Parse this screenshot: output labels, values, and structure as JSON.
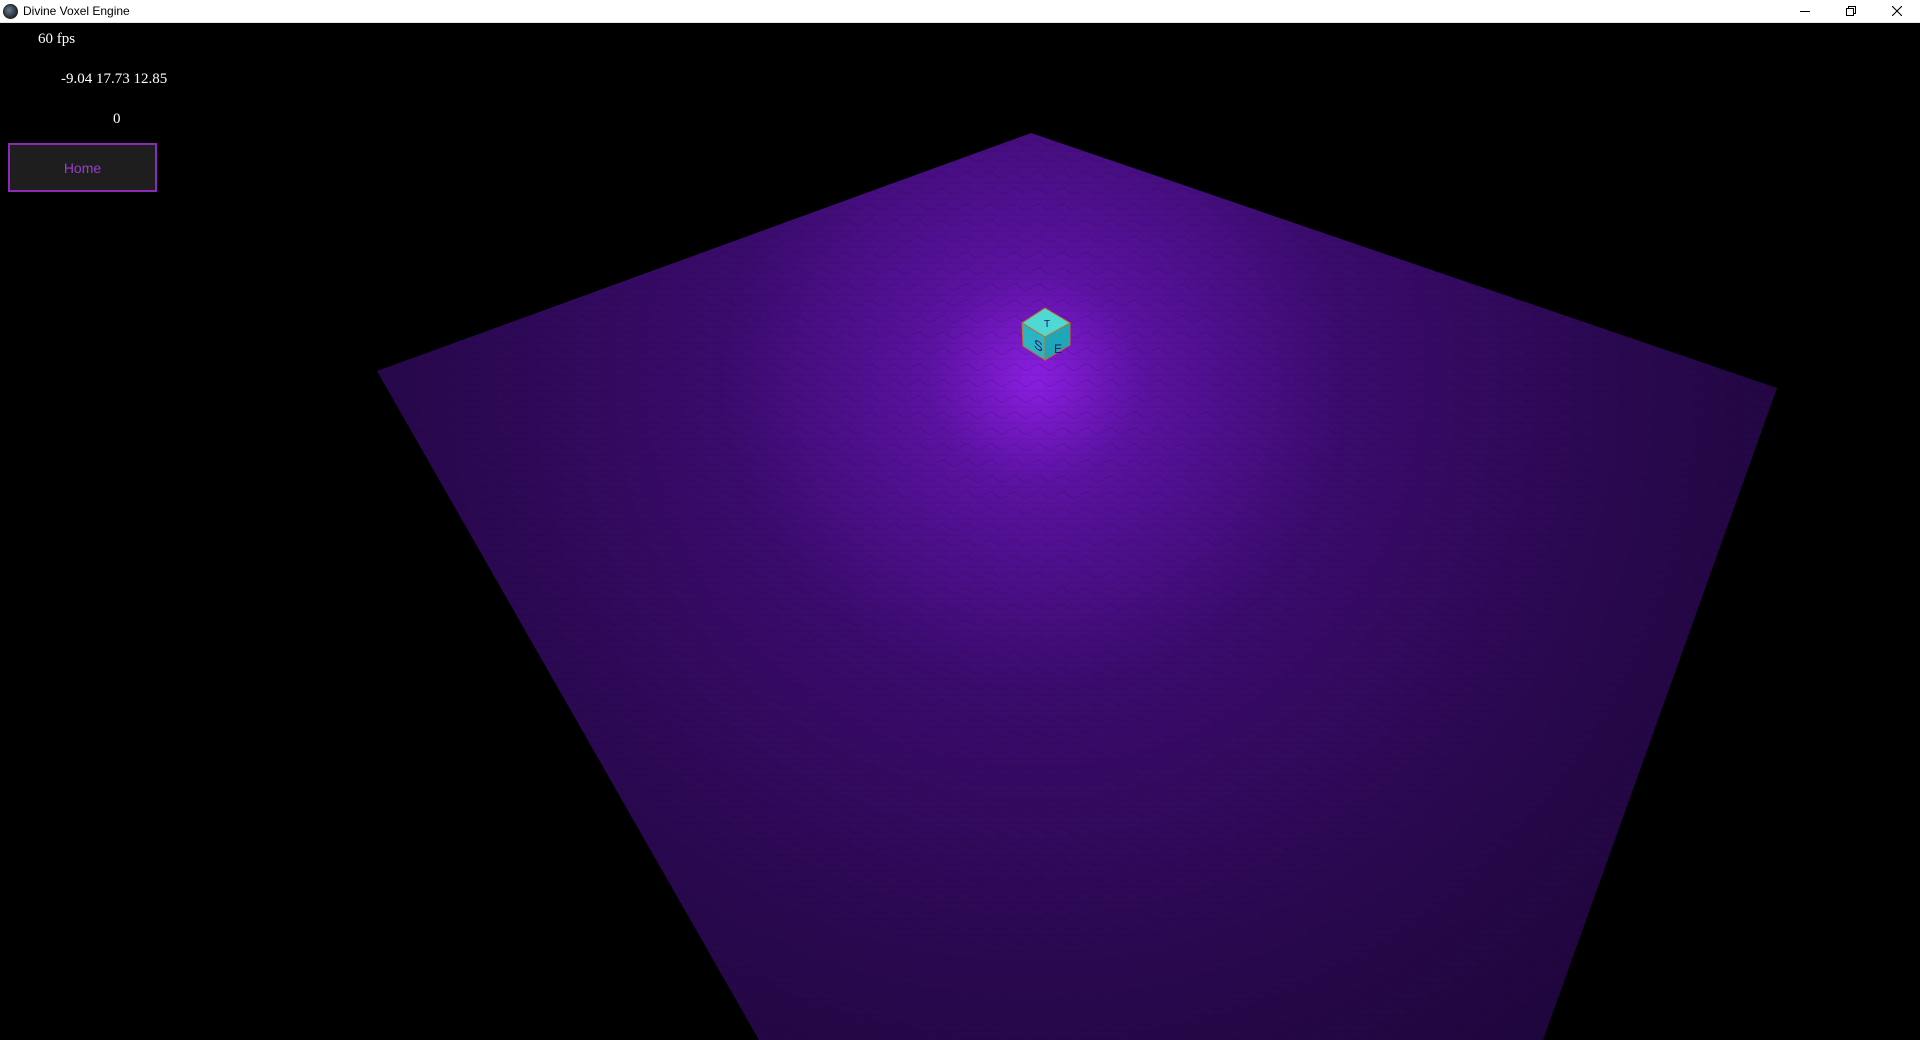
{
  "window": {
    "title": "Divine Voxel Engine",
    "controls": {
      "minimize": "minimize-icon",
      "restore": "restore-icon",
      "close": "close-icon"
    }
  },
  "hud": {
    "fps": "60 fps",
    "position": "-9.04 17.73 12.85",
    "counter": "0",
    "home_label": "Home"
  },
  "scene": {
    "background": "#000000",
    "ground_color": "#2a0a4a",
    "light_color": "#8a1ee0",
    "cube_color": "#2ec4c8",
    "cube_letters": [
      "S",
      "E",
      "T"
    ]
  }
}
